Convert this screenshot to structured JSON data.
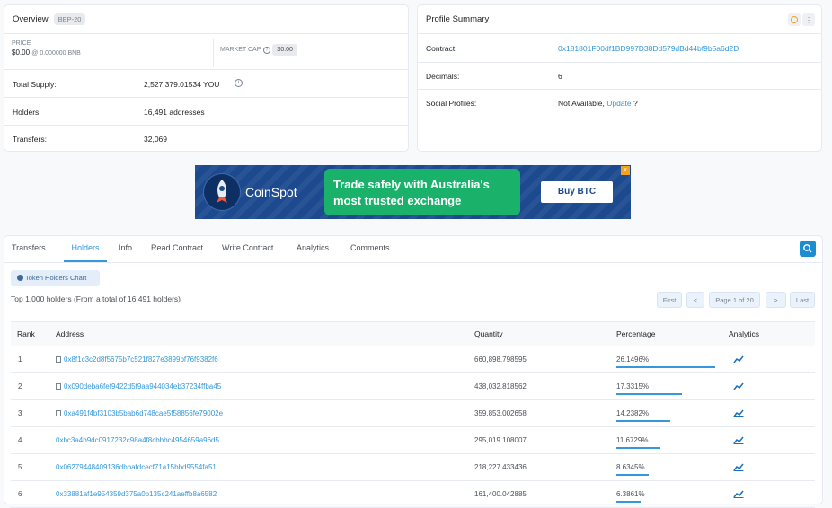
{
  "overview": {
    "title": "Overview",
    "badge": "BEP-20",
    "price_label": "PRICE",
    "price_value": "$0.00",
    "price_bnb": "@ 0.000000 BNB",
    "market_cap_label": "MARKET CAP",
    "market_cap_value": "$0.00",
    "total_supply_label": "Total Supply:",
    "total_supply_value": "2,527,379.01534 YOU",
    "holders_label": "Holders:",
    "holders_value": "16,491 addresses",
    "transfers_label": "Transfers:",
    "transfers_value": "32,069"
  },
  "profile": {
    "title": "Profile Summary",
    "contract_label": "Contract:",
    "contract_value": "0x181801F00df1BD997D38Dd579dBd44bf9b5a6d2D",
    "decimals_label": "Decimals:",
    "decimals_value": "6",
    "social_label": "Social Profiles:",
    "social_value": "Not Available,",
    "social_update": "Update",
    "social_q": "?"
  },
  "ad": {
    "brand": "CoinSpot",
    "headline_1": "Trade safely with Australia's",
    "headline_2": "most trusted exchange",
    "cta": "Buy BTC",
    "badge_color": "#f3a21b",
    "bg_color": "#1d4a8f",
    "bubble_color": "#1ab26b"
  },
  "tabs": [
    "Transfers",
    "Holders",
    "Info",
    "Read Contract",
    "Write Contract",
    "Analytics",
    "Comments"
  ],
  "holders": {
    "chart_button": "Token Holders Chart",
    "summary": "Top 1,000 holders (From a total of 16,491 holders)",
    "pagination": {
      "first": "First",
      "prev": "<",
      "page": "Page 1 of 20",
      "next": ">",
      "last": "Last"
    },
    "columns": [
      "Rank",
      "Address",
      "Quantity",
      "Percentage",
      "Analytics"
    ],
    "rows": [
      {
        "rank": "1",
        "address": "0x8f1c3c2d8f5675b7c521f827e3899bf76f9382f6",
        "contract": true,
        "quantity": "660,898.798595",
        "percentage": "26.1496%",
        "pct": 26.1496
      },
      {
        "rank": "2",
        "address": "0x090deba6fef9422d5f9aa944034eb37234ffba45",
        "contract": true,
        "quantity": "438,032.818562",
        "percentage": "17.3315%",
        "pct": 17.3315
      },
      {
        "rank": "3",
        "address": "0xa491f4bf3103b5bab6d748cae5f58856fe79002e",
        "contract": true,
        "quantity": "359,853.002658",
        "percentage": "14.2382%",
        "pct": 14.2382
      },
      {
        "rank": "4",
        "address": "0xbc3a4b9dc0917232c98a4f8cbbbc4954659a96d5",
        "contract": false,
        "quantity": "295,019.108007",
        "percentage": "11.6729%",
        "pct": 11.6729
      },
      {
        "rank": "5",
        "address": "0x06279448409136dbbafdcecf71a15bbd9554fa51",
        "contract": false,
        "quantity": "218,227.433436",
        "percentage": "8.6345%",
        "pct": 8.6345
      },
      {
        "rank": "6",
        "address": "0x33881af1e954359d375a0b135c241aeffb8a6582",
        "contract": false,
        "quantity": "161,400.042885",
        "percentage": "6.3861%",
        "pct": 6.3861
      }
    ]
  }
}
